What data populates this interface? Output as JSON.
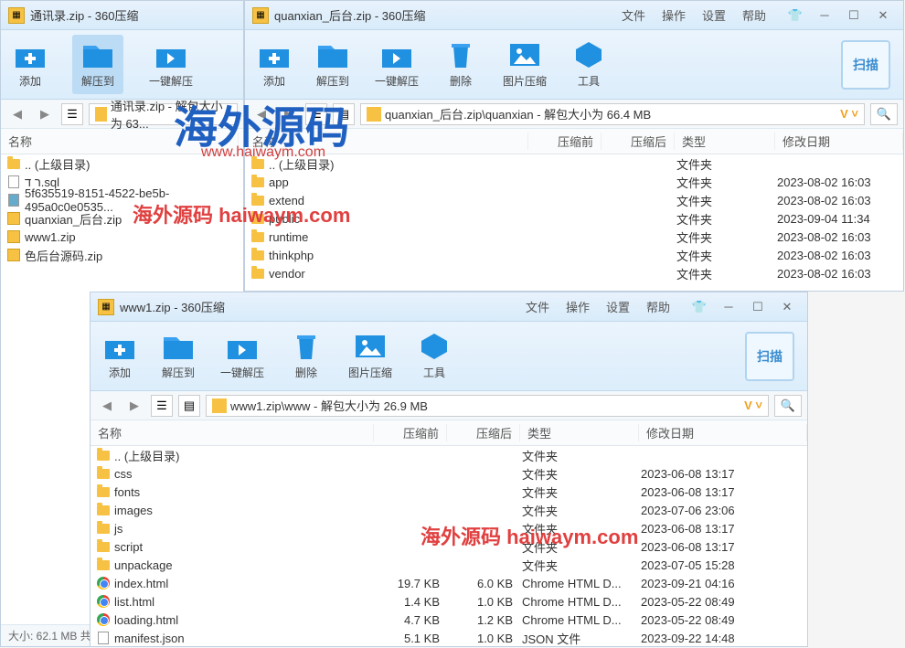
{
  "watermark": {
    "big": "海外源码",
    "url": "www.haiwaym.com",
    "red1": "海外源码 haiwaym.com",
    "red2": "海外源码 haiwaym.com"
  },
  "menu": {
    "file": "文件",
    "op": "操作",
    "settings": "设置",
    "help": "帮助"
  },
  "tools": {
    "add": "添加",
    "extract": "解压到",
    "oneclick": "一键解压",
    "delete": "删除",
    "imgcompress": "图片压缩",
    "tool": "工具",
    "scan": "扫描"
  },
  "headers": {
    "name": "名称",
    "before": "压缩前",
    "after": "压缩后",
    "type": "类型",
    "modified": "修改日期"
  },
  "types": {
    "folder": "文件夹",
    "chrome": "Chrome HTML D...",
    "json": "JSON 文件"
  },
  "statusbar": "大小: 62.1 MB 共",
  "win_a": {
    "title": "通讯录.zip - 360压缩",
    "crumb": "通讯录.zip - 解包大小为 63...",
    "files": [
      {
        "name": ".. (上级目录)",
        "ico": "folder"
      },
      {
        "name": "ר ד.sql",
        "ico": "file"
      },
      {
        "name": "5f635519-8151-4522-be5b-495a0c0e0535...",
        "ico": "jpg"
      },
      {
        "name": "quanxian_后台.zip",
        "ico": "zip"
      },
      {
        "name": "www1.zip",
        "ico": "zip"
      },
      {
        "name": "色后台源码.zip",
        "ico": "zip"
      }
    ]
  },
  "win_b": {
    "title": "quanxian_后台.zip - 360压缩",
    "crumb": "quanxian_后台.zip\\quanxian - 解包大小为 66.4 MB",
    "files": [
      {
        "name": ".. (上级目录)",
        "type": "文件夹",
        "date": ""
      },
      {
        "name": "app",
        "type": "文件夹",
        "date": "2023-08-02 16:03"
      },
      {
        "name": "extend",
        "type": "文件夹",
        "date": "2023-08-02 16:03"
      },
      {
        "name": "public",
        "type": "文件夹",
        "date": "2023-09-04 11:34"
      },
      {
        "name": "runtime",
        "type": "文件夹",
        "date": "2023-08-02 16:03"
      },
      {
        "name": "thinkphp",
        "type": "文件夹",
        "date": "2023-08-02 16:03"
      },
      {
        "name": "vendor",
        "type": "文件夹",
        "date": "2023-08-02 16:03"
      }
    ]
  },
  "win_c": {
    "title": "www1.zip - 360压缩",
    "crumb": "www1.zip\\www - 解包大小为 26.9 MB",
    "files": [
      {
        "name": ".. (上级目录)",
        "ico": "folder",
        "type": "文件夹"
      },
      {
        "name": "css",
        "ico": "folder",
        "type": "文件夹",
        "date": "2023-06-08 13:17"
      },
      {
        "name": "fonts",
        "ico": "folder",
        "type": "文件夹",
        "date": "2023-06-08 13:17"
      },
      {
        "name": "images",
        "ico": "folder",
        "type": "文件夹",
        "date": "2023-07-06 23:06"
      },
      {
        "name": "js",
        "ico": "folder",
        "type": "文件夹",
        "date": "2023-06-08 13:17"
      },
      {
        "name": "script",
        "ico": "folder",
        "type": "文件夹",
        "date": "2023-06-08 13:17"
      },
      {
        "name": "unpackage",
        "ico": "folder",
        "type": "文件夹",
        "date": "2023-07-05 15:28"
      },
      {
        "name": "index.html",
        "ico": "chrome",
        "before": "19.7 KB",
        "after": "6.0 KB",
        "type": "Chrome HTML D...",
        "date": "2023-09-21 04:16"
      },
      {
        "name": "list.html",
        "ico": "chrome",
        "before": "1.4 KB",
        "after": "1.0 KB",
        "type": "Chrome HTML D...",
        "date": "2023-05-22 08:49"
      },
      {
        "name": "loading.html",
        "ico": "chrome",
        "before": "4.7 KB",
        "after": "1.2 KB",
        "type": "Chrome HTML D...",
        "date": "2023-05-22 08:49"
      },
      {
        "name": "manifest.json",
        "ico": "file",
        "before": "5.1 KB",
        "after": "1.0 KB",
        "type": "JSON 文件",
        "date": "2023-09-22 14:48"
      }
    ]
  }
}
